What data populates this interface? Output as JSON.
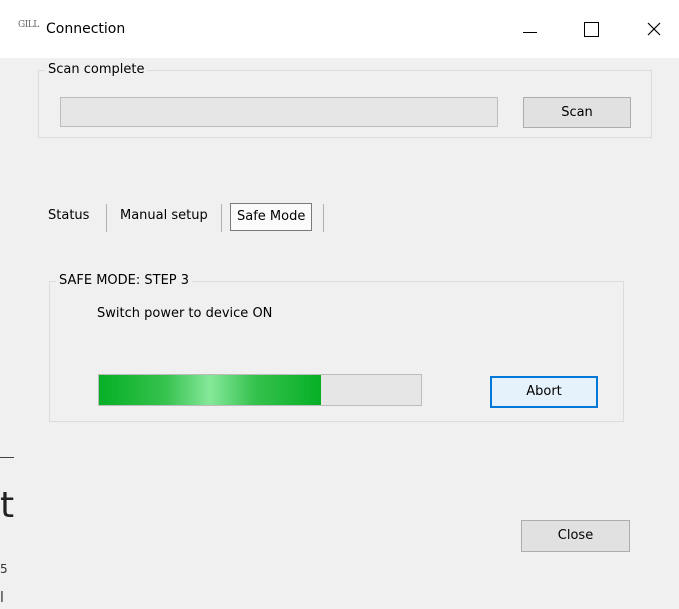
{
  "window": {
    "app_icon_text": "GILL",
    "title": "Connection",
    "controls": [
      "minimize-icon",
      "maximize-icon",
      "close-icon"
    ]
  },
  "scan": {
    "group_label": "Scan complete",
    "scan_button": "Scan"
  },
  "tabs": {
    "items": [
      "Status",
      "Manual setup",
      "Safe Mode"
    ],
    "selected": "Safe Mode"
  },
  "safe_mode": {
    "group_label": "SAFE MODE: STEP 3",
    "instruction": "Switch power to device ON",
    "progress_fraction": 0.69,
    "progress_color": "#06b025",
    "abort_button": "Abort"
  },
  "background_fragments": {
    "large_glyph": "t",
    "small_digit": "5",
    "small_mark": "l"
  },
  "footer": {
    "close_button": "Close"
  },
  "colors": {
    "focus_border": "#0078d7",
    "window_bg": "#f0f0f0"
  }
}
